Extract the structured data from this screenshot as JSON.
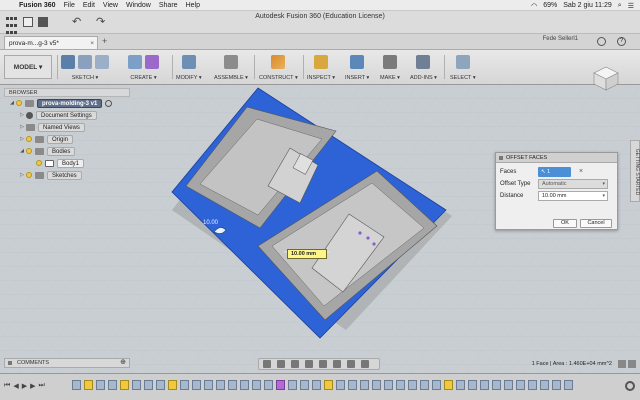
{
  "menubar": {
    "app_name": "Fusion 360",
    "items": [
      "File",
      "Edit",
      "View",
      "Window",
      "Share",
      "Help"
    ],
    "battery": "69%",
    "datetime": "Sab 2 giu  11:29"
  },
  "appbar": {
    "window_title": "Autodesk Fusion 360 (Education License)",
    "user_name": "Fede Sellerl1"
  },
  "tab": {
    "document_name": "prova-m...g-3 v5*",
    "close_glyph": "×",
    "add_glyph": "+"
  },
  "toolbar": {
    "workspace_label": "MODEL ▾",
    "groups": [
      {
        "label": "SKETCH ▾"
      },
      {
        "label": "CREATE ▾"
      },
      {
        "label": "MODIFY ▾"
      },
      {
        "label": "ASSEMBLE ▾"
      },
      {
        "label": "CONSTRUCT ▾"
      },
      {
        "label": "INSPECT ▾"
      },
      {
        "label": "INSERT ▾"
      },
      {
        "label": "MAKE ▾"
      },
      {
        "label": "ADD-INS ▾"
      },
      {
        "label": "SELECT ▾"
      }
    ]
  },
  "browser": {
    "header": "BROWSER",
    "items": [
      {
        "label": "prova-molding-3 v1"
      },
      {
        "label": "Document Settings"
      },
      {
        "label": "Named Views"
      },
      {
        "label": "Origin"
      },
      {
        "label": "Bodies"
      },
      {
        "label": "Body1"
      },
      {
        "label": "Sketches"
      }
    ]
  },
  "viewport": {
    "dimension_value": "10.00 mm",
    "model_label": "10.00"
  },
  "dialog": {
    "title": "OFFSET FACES",
    "faces_label": "Faces",
    "faces_value": "1 selected",
    "offset_type_label": "Offset Type",
    "offset_type_value": "Automatic",
    "distance_label": "Distance",
    "distance_value": "10.00 mm",
    "ok_label": "OK",
    "cancel_label": "Cancel"
  },
  "settings_tab": "GETTING STARTED",
  "comments": "COMMENTS",
  "status_text": "1 Face | Area : 1.460E+04 mm^2",
  "colors": {
    "viewport_bg": "#c9ced3",
    "selection_blue": "#2d63d6",
    "accent_blue": "#4b90d6",
    "dimension_yellow": "#fff68a"
  }
}
